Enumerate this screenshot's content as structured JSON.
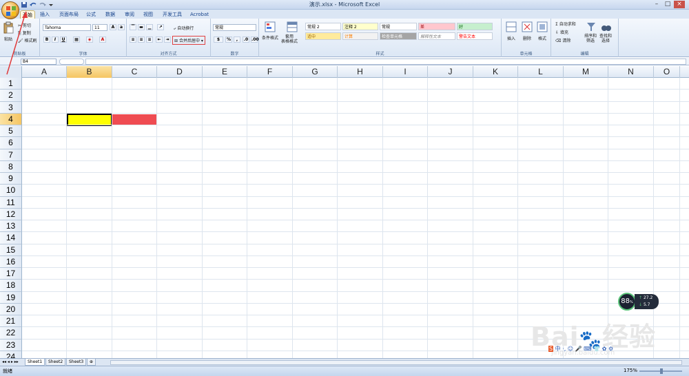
{
  "window": {
    "title": "演示.xlsx - Microsoft Excel"
  },
  "tabs": [
    "开始",
    "插入",
    "页面布局",
    "公式",
    "数据",
    "审阅",
    "视图",
    "开发工具",
    "Acrobat"
  ],
  "clipboard": {
    "paste": "粘贴",
    "cut": "剪切",
    "copy": "复制",
    "format_painter": "格式刷",
    "label": "剪贴板"
  },
  "font": {
    "name": "Tahoma",
    "size": "11",
    "label": "字体"
  },
  "alignment": {
    "wrap": "自动换行",
    "merge": "合并后居中",
    "label": "对齐方式"
  },
  "number": {
    "format": "常规",
    "label": "数字"
  },
  "styles": {
    "conditional": "条件格式",
    "table": "套用\n表格格式",
    "cells": [
      {
        "text": "常规 2",
        "bg": "#ffffff",
        "color": "#000000"
      },
      {
        "text": "注释 2",
        "bg": "#ffffcc",
        "color": "#000000"
      },
      {
        "text": "常规",
        "bg": "#ffffff",
        "color": "#000000"
      },
      {
        "text": "差",
        "bg": "#ffc7ce",
        "color": "#9c0006"
      },
      {
        "text": "好",
        "bg": "#c6efce",
        "color": "#006100"
      },
      {
        "text": "适中",
        "bg": "#ffeb9c",
        "color": "#9c6500"
      },
      {
        "text": "计算",
        "bg": "#f2f2f2",
        "color": "#fa7d00"
      },
      {
        "text": "检查单元格",
        "bg": "#a5a5a5",
        "color": "#ffffff"
      },
      {
        "text": "解释性文本",
        "bg": "#ffffff",
        "color": "#7f7f7f"
      },
      {
        "text": "警告文本",
        "bg": "#ffffff",
        "color": "#ff0000"
      }
    ],
    "label": "样式"
  },
  "cells_group": {
    "insert": "插入",
    "delete": "删除",
    "format": "格式",
    "label": "单元格"
  },
  "editing": {
    "autosum": "自动求和",
    "fill": "填充",
    "clear": "清除",
    "sort": "排序和\n筛选",
    "find": "查找和\n选择",
    "label": "编辑"
  },
  "name_box": "B4",
  "columns": [
    "A",
    "B",
    "C",
    "D",
    "E",
    "F",
    "G",
    "H",
    "I",
    "J",
    "K",
    "L",
    "M",
    "N",
    "O"
  ],
  "rows": [
    "1",
    "2",
    "3",
    "4",
    "5",
    "6",
    "7",
    "8",
    "9",
    "10",
    "11",
    "12",
    "13",
    "14",
    "15",
    "16",
    "17",
    "18",
    "19",
    "20",
    "21",
    "22",
    "23",
    "24"
  ],
  "selection": {
    "active_col": "B",
    "active_row": "4",
    "b4_color": "#ffff00",
    "c4_color": "#ef4c52"
  },
  "sheets": [
    "Sheet1",
    "Sheet2",
    "Sheet3"
  ],
  "status": {
    "ready": "就绪",
    "zoom": "175%"
  },
  "widget": {
    "cpu": "88",
    "cpu_unit": "%",
    "up": "27.2",
    "down": "5.7"
  },
  "watermark": {
    "brand": "Bai",
    "brand2": "经验",
    "url": "jingyan.baidu.com"
  }
}
